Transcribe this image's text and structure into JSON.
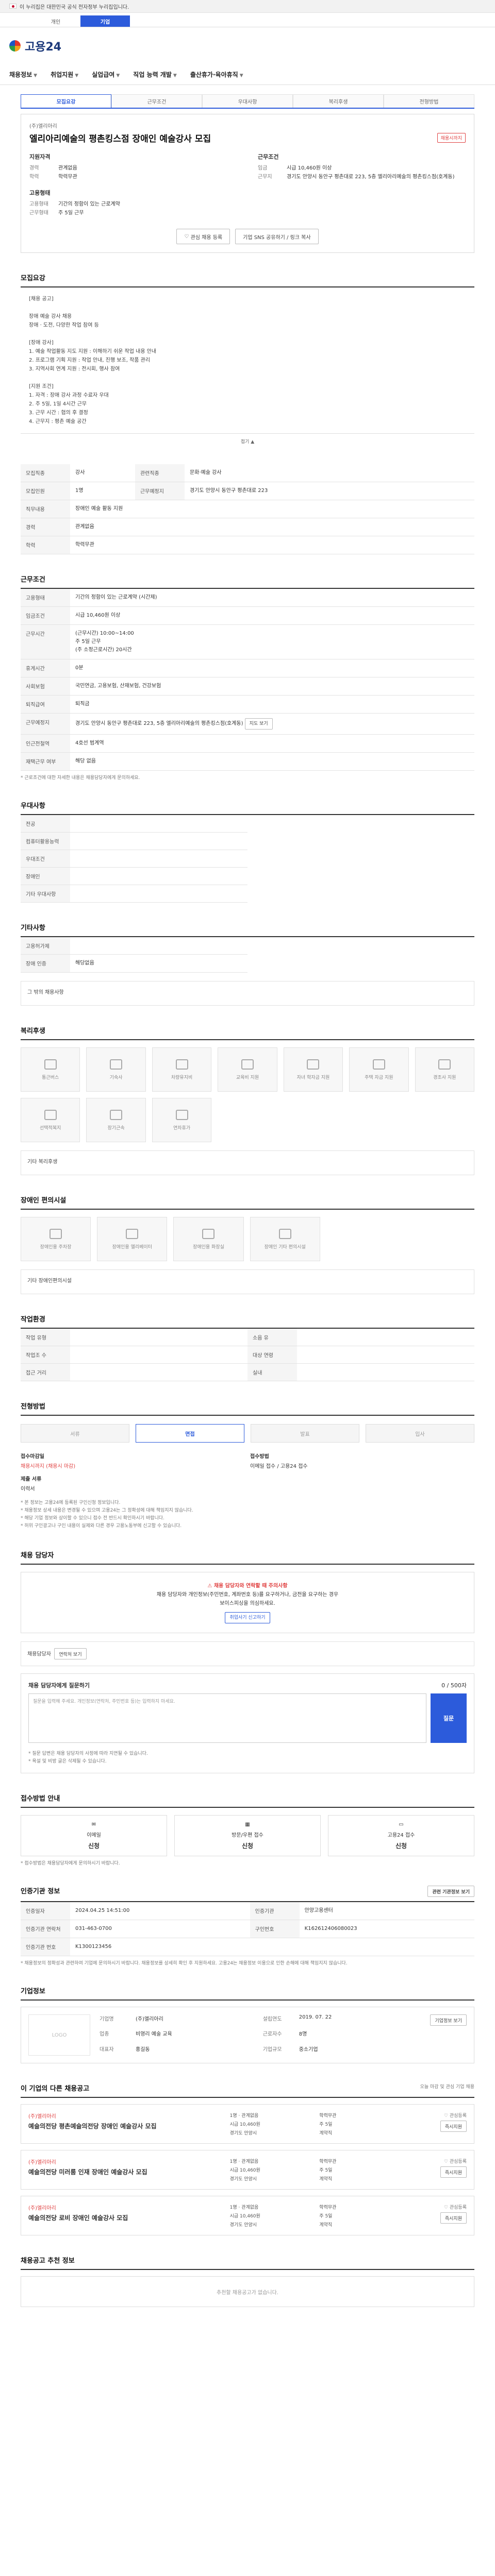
{
  "gov_banner": "이 누리집은 대한민국 공식 전자정부 누리집입니다.",
  "top_tabs": [
    "개인",
    "기업"
  ],
  "logo": "고용24",
  "gnb": [
    "채용정보",
    "취업지원",
    "실업급여",
    "직업 능력 개발",
    "출산휴가·육아휴직"
  ],
  "sub_tabs": [
    "모집요강",
    "근무조건",
    "우대사항",
    "복리후생",
    "전형방법"
  ],
  "summary": {
    "company": "(주)엘리아리",
    "title": "엘리아리예술의 평촌킹스점 장애인 예술강사 모집",
    "badge": "채용시까지",
    "left_header": "지원자격",
    "left_rows": [
      {
        "k": "경력",
        "v": "관계없음"
      },
      {
        "k": "학력",
        "v": "학력무관"
      }
    ],
    "left_header2": "고용형태",
    "left_rows2": [
      {
        "k": "고용형태",
        "v": "기간의 정함이 있는 근로계약"
      },
      {
        "k": "근무형태",
        "v": "주 5일 근무"
      }
    ],
    "right_header": "근무조건",
    "right_rows": [
      {
        "k": "임금",
        "v": "시급 10,460원 이상"
      },
      {
        "k": "근무지",
        "v": "경기도 안양시 동안구 평촌대로 223, 5층 엘리아리예술의 평촌킹스점(호계동)"
      }
    ],
    "btn_like": "관심 채용 등록",
    "btn_share": "기업 SNS 공유하기 / 링크 복사"
  },
  "intro": {
    "title": "모집요강",
    "text": "[채용 공고]\n\n장애 예술 강사 채용\n장애 · 도전, 다양한 작업 참여 등\n\n[장애 강사]\n1. 예술 작업활동 지도 지원 : 이해하기 쉬운 작업 내용 안내\n2. 프로그램 기획 지원 : 작업 안내, 진행 보조, 작품 관리\n3. 지역사회 연계 지원 : 전시회, 행사 참여\n\n[지원 조건]\n1. 자격 : 장애 강사 과정 수료자 우대\n2. 주 5일, 1일 4시간 근무\n3. 근무 시간 : 협의 후 결정\n4. 근무지 : 평촌 예술 공간",
    "more": "접기"
  },
  "recruit_table": {
    "rows": [
      [
        {
          "k": "모집직종",
          "v": "강사"
        },
        {
          "k": "관련직종",
          "v": "문화·예술 강사"
        }
      ],
      [
        {
          "k": "모집인원",
          "v": "1명"
        },
        {
          "k": "근무예정지",
          "v": "경기도 안양시 동안구 평촌대로 223"
        }
      ]
    ],
    "extra": [
      {
        "k": "직무내용",
        "v": "장애인 예술 활동 지원"
      },
      {
        "k": "경력",
        "v": "관계없음"
      },
      {
        "k": "학력",
        "v": "학력무관"
      }
    ]
  },
  "conditions": {
    "title": "근무조건",
    "rows": [
      {
        "k": "고용형태",
        "v": "기간의 정함이 있는 근로계약 (시간제)"
      },
      {
        "k": "임금조건",
        "v": "시급 10,460원 이상"
      },
      {
        "k": "근무시간",
        "v": "(근무시간) 10:00~14:00\n주 5일 근무\n(주 소정근로시간) 20시간"
      },
      {
        "k": "휴게시간",
        "v": "0분"
      },
      {
        "k": "사회보험",
        "v": "국민연금, 고용보험, 산재보험, 건강보험"
      },
      {
        "k": "퇴직급여",
        "v": "퇴직금"
      },
      {
        "k": "근무예정지",
        "v": "경기도 안양시 동안구 평촌대로 223, 5층 엘리아리예술의 평촌킹스점(호계동)"
      },
      {
        "k": "인근전철역",
        "v": "4호선 범계역"
      },
      {
        "k": "재택근무 여부",
        "v": "해당 없음"
      }
    ],
    "map_btn": "지도 보기",
    "note": "* 근로조건에 대한 자세한 내용은 채용담당자에게 문의하세요."
  },
  "prefer": {
    "title": "우대사항",
    "rows": [
      {
        "k": "전공",
        "v": ""
      },
      {
        "k": "컴퓨터활용능력",
        "v": ""
      },
      {
        "k": "우대조건",
        "v": ""
      },
      {
        "k": "장애인",
        "v": ""
      },
      {
        "k": "기타 우대사항",
        "v": ""
      }
    ]
  },
  "extra_info": {
    "title": "기타사항",
    "rows": [
      {
        "k": "고용허가제",
        "v": ""
      },
      {
        "k": "장애 인증",
        "v": "해당없음"
      }
    ],
    "box": "그 밖의 채용사항"
  },
  "welfare": {
    "title": "복리후생",
    "items": [
      "통근버스",
      "기숙사",
      "차량유지비",
      "교육비 지원",
      "자녀 학자금 지원",
      "주택 자금 지원",
      "경조사 지원",
      "선택적복지",
      "장기근속",
      "연차휴가"
    ],
    "other": "기타 복리후생"
  },
  "disability": {
    "title": "장애인 편의시설",
    "items": [
      "장애인용 주차장",
      "장애인용 엘리베이터",
      "장애인용 화장실",
      "장애인 기타 편의시설"
    ],
    "other": "기타 장애인편의시설"
  },
  "environment": {
    "title": "작업환경",
    "rows": [
      {
        "k": "작업 유형",
        "v": ""
      },
      {
        "k": "소음 유",
        "v": ""
      },
      {
        "k": "작업조 수",
        "v": ""
      },
      {
        "k": "대상 연령",
        "v": ""
      },
      {
        "k": "접근 거리",
        "v": ""
      },
      {
        "k": "실내",
        "v": ""
      }
    ]
  },
  "process": {
    "title": "전형방법",
    "steps": [
      "서류",
      "면접",
      "발표",
      "입사"
    ],
    "deadline_k": "접수마감일",
    "deadline_v": "채용시까지 (채용시 마감)",
    "method_k": "접수방법",
    "method_v": "이메일 접수 / 고용24 접수",
    "doc_k": "제출 서류",
    "doc_v": "이력서",
    "warns": [
      "* 본 정보는 고용24에 등록된 구인신청 정보입니다.",
      "* 채용정보 상세 내용은 변경될 수 있으며 고용24는 그 정확성에 대해 책임지지 않습니다.",
      "* 해당 기업 정보와 상이할 수 있으니 접수 전 반드시 확인하시기 바랍니다.",
      "* 허위 구인광고나 구인 내용이 실제와 다른 경우 고용노동부에 신고할 수 있습니다."
    ]
  },
  "manager": {
    "title": "채용 담당자",
    "alert_title": "채용 담당자와 연락할 때 주의사항",
    "alert_text": "채용 담당자와 개인정보(주민번호, 계좌번호 등)를 요구하거나, 금전을 요구하는 경우\n보이스피싱을 의심하세요.",
    "alert_btn": "취업사기 신고하기",
    "contact_k": "채용담당자",
    "contact_btn": "연락처 보기",
    "q_title": "채용 담당자에게 질문하기",
    "q_count": "0 / 500자",
    "q_placeholder": "질문을 입력해 주세요. 개인정보(연락처, 주민번호 등)는 입력하지 마세요.",
    "q_btn": "질문",
    "q_notes": [
      "* 질문 답변은 채용 담당자의 사정에 따라 지연될 수 있습니다.",
      "* 욕설 및 비방 글은 삭제될 수 있습니다."
    ]
  },
  "method": {
    "title": "접수방법 안내",
    "items": [
      {
        "k": "이메일",
        "v": "신청"
      },
      {
        "k": "방문/우편 접수",
        "v": "신청"
      },
      {
        "k": "고용24 접수",
        "v": "신청"
      }
    ],
    "note": "* 접수방법은 채용담당자에게 문의하시기 바랍니다."
  },
  "registration": {
    "title": "인증기관 정보",
    "btn": "관련 기관정보 보기",
    "rows": [
      [
        {
          "k": "인증일자",
          "v": "2024.04.25 14:51:00"
        },
        {
          "k": "인증기관",
          "v": "안양고용센터"
        },
        {
          "k": "인증기관 연락처",
          "v": "031-463-0700"
        }
      ],
      [
        {
          "k": "인증기관 번호",
          "v": "K1300123456"
        },
        {
          "k": "구인번호",
          "v": "K162612406080023"
        }
      ]
    ],
    "warn": "* 채용정보의 정확성과 관련하여 기업에 문의하시기 바랍니다. 채용정보를 상세히 확인 후 지원하세요. 고용24는 채용정보 이용으로 인한 손해에 대해 책임지지 않습니다."
  },
  "company": {
    "title": "기업정보",
    "logo": "LOGO",
    "rows": [
      {
        "k": "기업명",
        "v": "(주)엘리아리"
      },
      {
        "k": "설립연도",
        "v": "2019. 07. 22"
      },
      {
        "k": "업종",
        "v": "비영리 예술 교육"
      },
      {
        "k": "근로자수",
        "v": "8명"
      },
      {
        "k": "대표자",
        "v": "홍길동"
      },
      {
        "k": "기업규모",
        "v": "중소기업"
      }
    ],
    "btn": "기업정보 보기"
  },
  "related": {
    "title": "이 기업의 다른 채용공고",
    "note": "오늘 마감 및 관심 기업 채용",
    "items": [
      {
        "company": "(주)엘리아리",
        "title": "예술의전당 평촌예술의전당 장애인 예술강사 모집",
        "meta": [
          "1명 · 관계없음",
          "학력무관",
          "시급 10,460원",
          "주 5일",
          "경기도 안양시",
          "계약직"
        ]
      },
      {
        "company": "(주)엘리아리",
        "title": "예술의전당 미러룸 인재 장애인 예술강사 모집",
        "meta": [
          "1명 · 관계없음",
          "학력무관",
          "시급 10,460원",
          "주 5일",
          "경기도 안양시",
          "계약직"
        ]
      },
      {
        "company": "(주)엘리아리",
        "title": "예술의전당 로비 장애인 예술강사 모집",
        "meta": [
          "1명 · 관계없음",
          "학력무관",
          "시급 10,460원",
          "주 5일",
          "경기도 안양시",
          "계약직"
        ]
      }
    ],
    "like": "관심등록",
    "apply": "즉시지원"
  },
  "recommend": {
    "title": "채용공고 추천 정보",
    "empty": "추천할 채용공고가 없습니다."
  }
}
